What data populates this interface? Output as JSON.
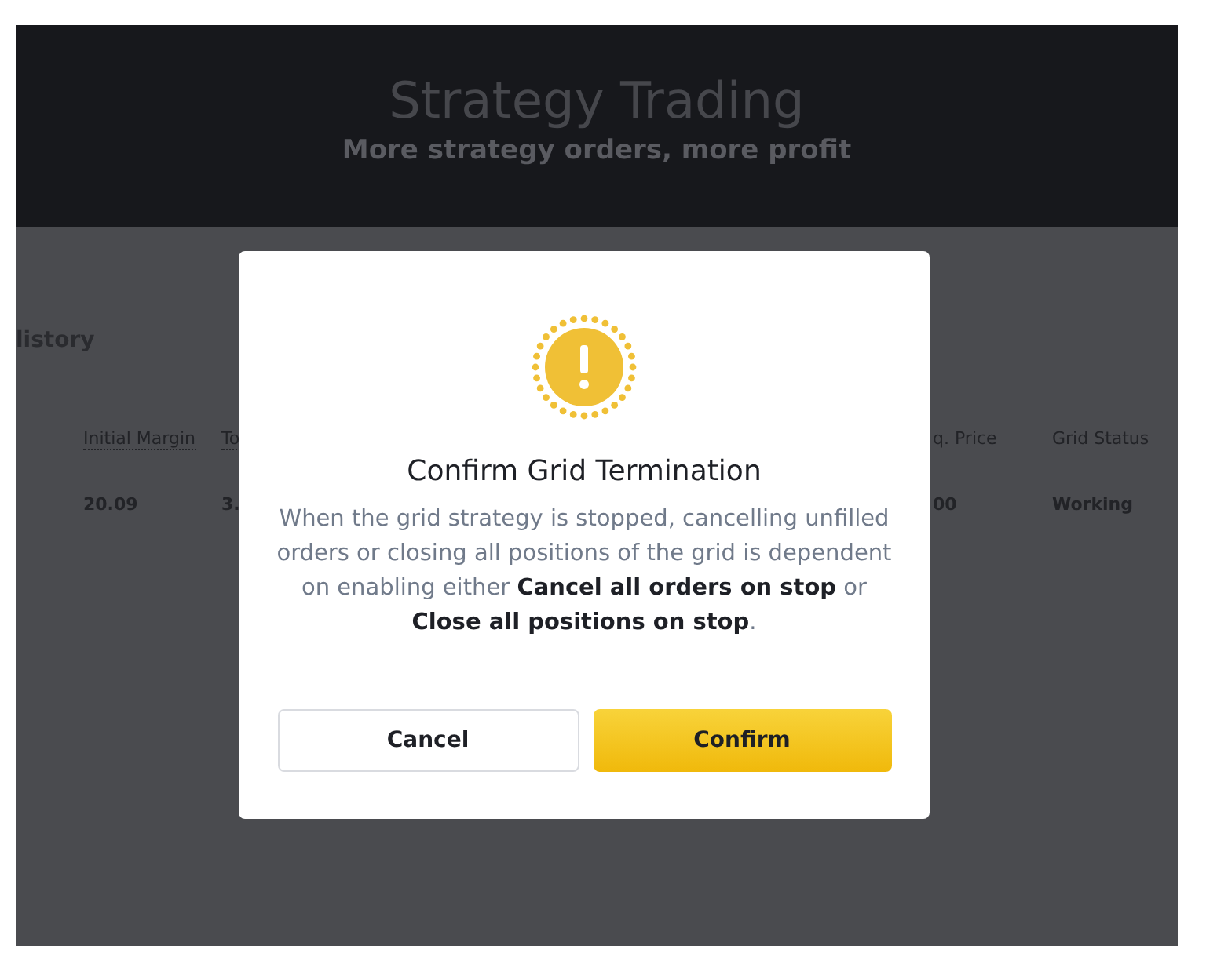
{
  "header": {
    "title": "Strategy Trading",
    "subtitle": "More strategy orders, more profit"
  },
  "section_title": "listory",
  "table": {
    "columns": [
      {
        "label": "Initial Margin",
        "underlined": true
      },
      {
        "label": "To",
        "underlined": true
      },
      {
        "label": "q. Price",
        "underlined": false
      },
      {
        "label": "Grid Status",
        "underlined": false
      }
    ],
    "rows": [
      [
        "20.09",
        "3.",
        "00",
        "Working"
      ]
    ]
  },
  "dialog": {
    "title": "Confirm Grid Termination",
    "message": "When the grid strategy is stopped, cancelling unfilled orders or closing all positions of the grid is dependent on enabling either **Cancel all orders on stop** or **Close all positions on stop**.",
    "buttons": [
      {
        "label": "Cancel",
        "kind": "secondary"
      },
      {
        "label": "Confirm",
        "kind": "primary"
      }
    ]
  }
}
